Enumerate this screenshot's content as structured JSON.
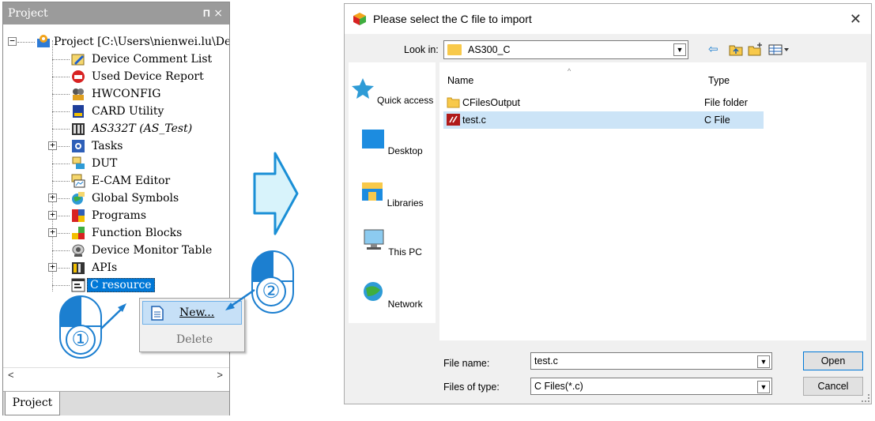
{
  "project_panel": {
    "title": "Project",
    "pin_glyph": "ᛯ",
    "close_glyph": "×",
    "tree": [
      {
        "label": "Project [C:\\Users\\nienwei.lu\\De:",
        "icon": "project-icon",
        "expander": "⊟"
      },
      {
        "label": "Device Comment List",
        "icon": "pencil-icon"
      },
      {
        "label": "Used Device Report",
        "icon": "report-icon"
      },
      {
        "label": "HWCONFIG",
        "icon": "hwconfig-icon"
      },
      {
        "label": "CARD Utility",
        "icon": "card-icon"
      },
      {
        "label": "AS332T  (AS_Test)",
        "icon": "plc-icon"
      },
      {
        "label": "Tasks",
        "icon": "tasks-icon",
        "expander": "⊞"
      },
      {
        "label": "DUT",
        "icon": "dut-icon"
      },
      {
        "label": "E-CAM Editor",
        "icon": "ecam-icon"
      },
      {
        "label": "Global Symbols",
        "icon": "globe-icon",
        "expander": "⊞"
      },
      {
        "label": "Programs",
        "icon": "programs-icon",
        "expander": "⊞"
      },
      {
        "label": "Function Blocks",
        "icon": "function-blocks-icon",
        "expander": "⊞"
      },
      {
        "label": "Device Monitor Table",
        "icon": "monitor-icon"
      },
      {
        "label": "APIs",
        "icon": "apis-icon",
        "expander": "⊞"
      },
      {
        "label": "C resource",
        "icon": "c-resource-icon",
        "selected": true
      }
    ],
    "scroll_left": "<",
    "scroll_right": ">",
    "bottom_tab": "Project"
  },
  "context_menu": {
    "new_label": "New...",
    "delete_label": "Delete"
  },
  "callouts": {
    "step1": "①",
    "step2": "②"
  },
  "dialog": {
    "title": "Please select the C file to import",
    "close_glyph": "✕",
    "look_in_label": "Look in:",
    "look_in_value": "AS300_C",
    "toolbar_icons": [
      "back-icon",
      "up-folder-icon",
      "new-folder-icon",
      "view-menu-icon"
    ],
    "places": [
      {
        "label": "Quick access",
        "icon": "star-icon"
      },
      {
        "label": "Desktop",
        "icon": "desktop-icon"
      },
      {
        "label": "Libraries",
        "icon": "libraries-icon"
      },
      {
        "label": "This PC",
        "icon": "pc-icon"
      },
      {
        "label": "Network",
        "icon": "network-icon"
      }
    ],
    "columns": {
      "name": "Name",
      "type": "Type"
    },
    "files": [
      {
        "name": "CFilesOutput",
        "type": "File folder",
        "icon": "folder-icon",
        "selected": false
      },
      {
        "name": "test.c",
        "type": "C File",
        "icon": "c-file-icon",
        "selected": true
      }
    ],
    "file_name_label": "File name:",
    "file_name_value": "test.c",
    "file_type_label": "Files of type:",
    "file_type_value": "C Files(*.c)",
    "open_label": "Open",
    "cancel_label": "Cancel"
  },
  "colors": {
    "title_gray": "#9b9b9b",
    "selection_blue": "#cce4f7",
    "menu_highlight": "#c6e0f7",
    "arrow_fill": "#d8f3fb",
    "arrow_stroke": "#1a8fd6",
    "mouse_blue": "#1c7fd0",
    "folder_yellow": "#f8c94a"
  }
}
